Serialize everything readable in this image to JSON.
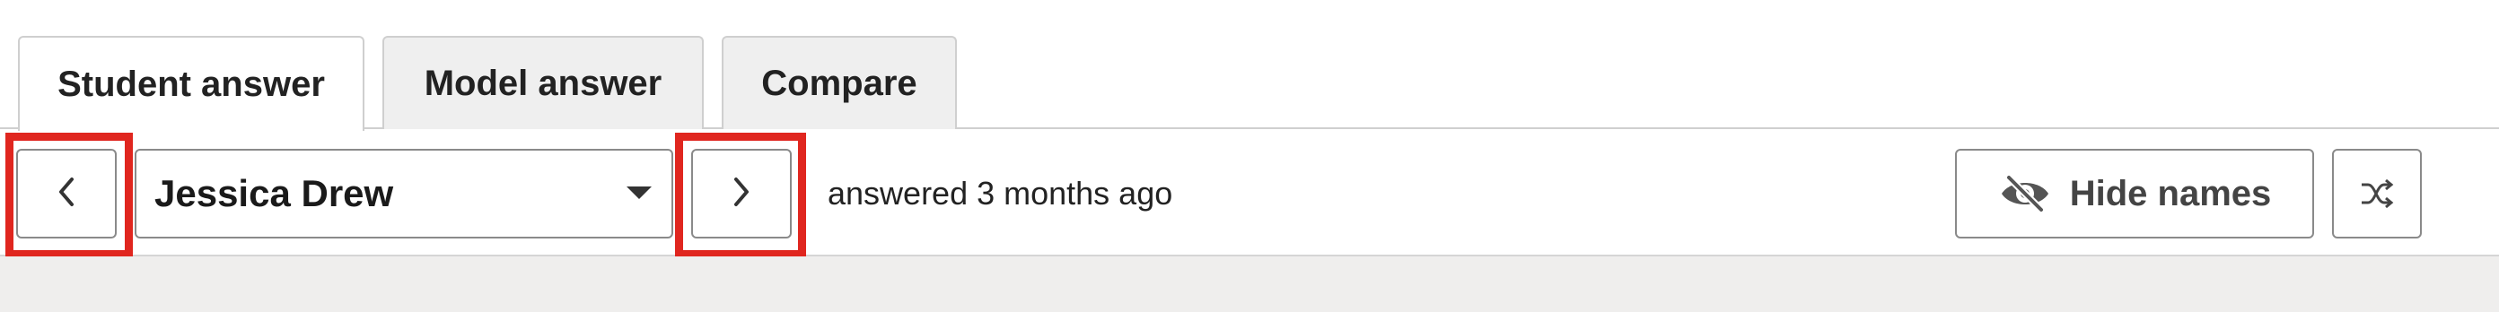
{
  "tabs": [
    {
      "label": "Student answer",
      "active": true
    },
    {
      "label": "Model answer",
      "active": false
    },
    {
      "label": "Compare",
      "active": false
    }
  ],
  "toolbar": {
    "prev_icon": "chevron-left-icon",
    "next_icon": "chevron-right-icon",
    "student_select": {
      "value": "Jessica Drew"
    },
    "answered_text": "answered 3 months ago",
    "hide_names_label": "Hide names",
    "hide_names_icon": "eye-slash-icon",
    "shuffle_icon": "shuffle-icon"
  },
  "colors": {
    "highlight": "#e0261f",
    "tab_inactive_bg": "#efefef",
    "footer_bg": "#efeeed",
    "border": "#8a8a8a"
  }
}
